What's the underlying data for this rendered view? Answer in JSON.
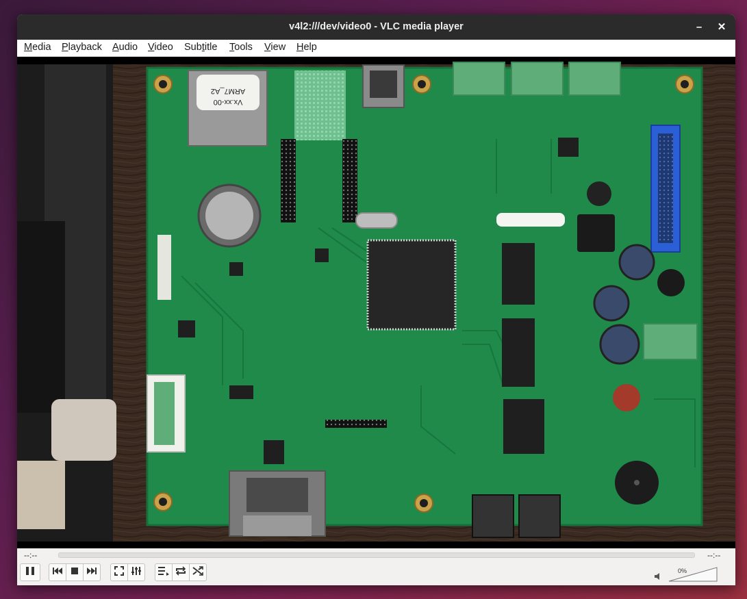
{
  "window": {
    "title": "v4l2:///dev/video0 - VLC media player",
    "minimize_glyph": "–",
    "close_glyph": "✕"
  },
  "menu": [
    {
      "label": "Media",
      "mnemonic": "M",
      "rest": "edia"
    },
    {
      "label": "Playback",
      "mnemonic": "P",
      "rest": "layback"
    },
    {
      "label": "Audio",
      "mnemonic": "A",
      "rest": "udio"
    },
    {
      "label": "Video",
      "mnemonic": "V",
      "rest": "ideo"
    },
    {
      "label": "Subtitle",
      "mnemonic": "t",
      "pre": "Sub",
      "rest": "itle"
    },
    {
      "label": "Tools",
      "mnemonic": "T",
      "rest": "ools"
    },
    {
      "label": "View",
      "mnemonic": "V",
      "rest": "iew"
    },
    {
      "label": "Help",
      "mnemonic": "H",
      "rest": "elp"
    }
  ],
  "video": {
    "content": "live camera feed of a green circuit board",
    "chip_labels": [
      "ARM7_A2",
      "Vx.xx-00"
    ]
  },
  "controls": {
    "elapsed": "--:--",
    "remaining": "--:--",
    "seek_progress": 0,
    "volume_percent": "0%",
    "volume_level": 0,
    "icons": {
      "pause": "pause-icon",
      "previous": "previous-icon",
      "stop": "stop-icon",
      "next": "next-icon",
      "fullscreen": "fullscreen-icon",
      "extended": "equalizer-icon",
      "playlist": "playlist-icon",
      "loop": "loop-icon",
      "shuffle": "shuffle-icon",
      "speaker": "speaker-icon"
    }
  },
  "colors": {
    "titlebar": "#2b2b2b",
    "pcb_green": "#1f8a4a",
    "ribbon_connector": "#2a5fd6",
    "terminal_green": "#5fae7a"
  }
}
